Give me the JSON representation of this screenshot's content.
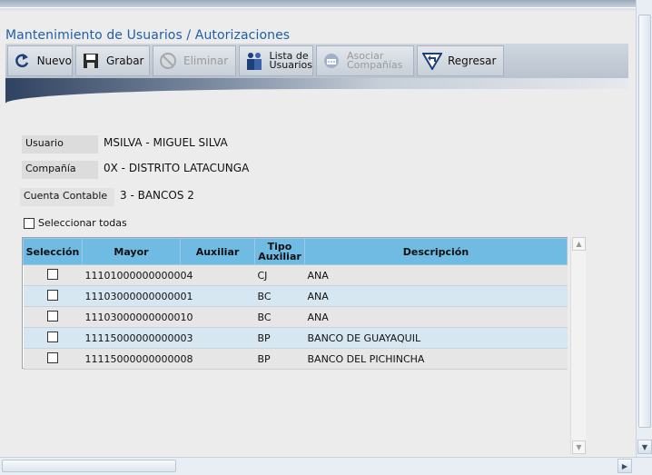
{
  "page": {
    "title": "Mantenimiento de Usuarios / Autorizaciones"
  },
  "toolbar": {
    "nuevo": "Nuevo",
    "grabar": "Grabar",
    "eliminar": "Eliminar",
    "lista_line1": "Lista de",
    "lista_line2": "Usuarios",
    "asociar_line1": "Asociar",
    "asociar_line2": "Compañías",
    "regresar": "Regresar"
  },
  "form": {
    "usuario_label": "Usuario",
    "usuario_value": "MSILVA - MIGUEL SILVA",
    "compania_label": "Compañía",
    "compania_value": "0X - DISTRITO LATACUNGA",
    "cuenta_label": "Cuenta Contable",
    "cuenta_value": "3 - BANCOS 2",
    "select_all_label": "Seleccionar todas"
  },
  "table": {
    "headers": {
      "seleccion": "Selección",
      "mayor": "Mayor",
      "auxiliar": "Auxiliar",
      "tipo_line1": "Tipo",
      "tipo_line2": "Auxiliar",
      "descripcion": "Descripción"
    },
    "rows": [
      {
        "mayor": "111010000000000",
        "auxiliar": "04",
        "tipo": "CJ",
        "descripcion": "ANA"
      },
      {
        "mayor": "111030000000000",
        "auxiliar": "01",
        "tipo": "BC",
        "descripcion": "ANA"
      },
      {
        "mayor": "111030000000000",
        "auxiliar": "10",
        "tipo": "BC",
        "descripcion": "ANA"
      },
      {
        "mayor": "111150000000000",
        "auxiliar": "03",
        "tipo": "BP",
        "descripcion": "BANCO DE GUAYAQUIL"
      },
      {
        "mayor": "111150000000000",
        "auxiliar": "08",
        "tipo": "BP",
        "descripcion": "BANCO DEL PICHINCHA"
      }
    ]
  },
  "icons": [
    "nuevo-icon",
    "grabar-icon",
    "eliminar-icon",
    "lista-usuarios-icon",
    "asociar-companias-icon",
    "regresar-icon"
  ],
  "colors": {
    "title": "#1f5fa8",
    "header": "#6fbbe3",
    "row_odd": "#e6e6e6",
    "row_even": "#d7e7f1"
  }
}
